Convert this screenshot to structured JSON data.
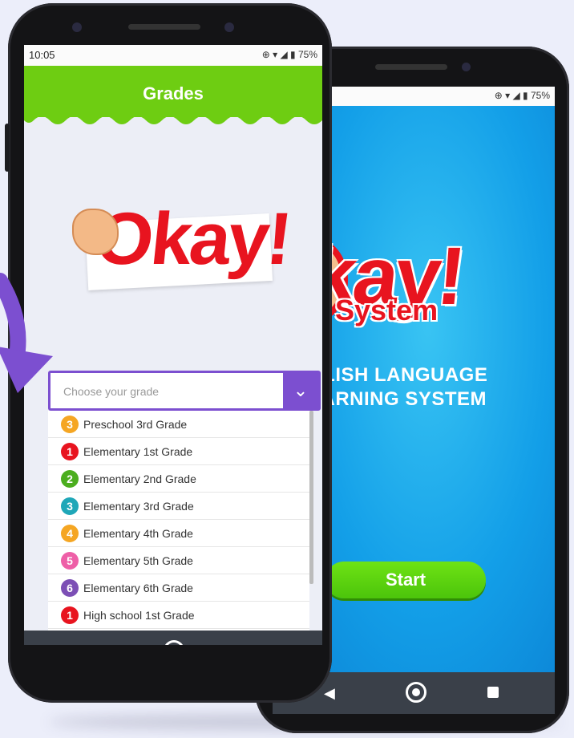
{
  "colors": {
    "header_green": "#6ecd12",
    "accent_purple": "#7c4fd0",
    "logo_red": "#e8141f",
    "background": "#eceefa"
  },
  "front_phone": {
    "status": {
      "time": "10:05",
      "battery": "75%"
    },
    "header_title": "Grades",
    "logo_text": "Okay!",
    "grade_select": {
      "placeholder": "Choose your grade",
      "toggle_icon": "chevron-down-icon"
    },
    "grades": [
      {
        "badge": "3",
        "label": "Preschool 3rd Grade",
        "color": "#f5a623"
      },
      {
        "badge": "1",
        "label": "Elementary 1st Grade",
        "color": "#e8141f"
      },
      {
        "badge": "2",
        "label": "Elementary 2nd Grade",
        "color": "#4cae1f"
      },
      {
        "badge": "3",
        "label": "Elementary 3rd Grade",
        "color": "#1fa7b8"
      },
      {
        "badge": "4",
        "label": "Elementary 4th Grade",
        "color": "#f5a623"
      },
      {
        "badge": "5",
        "label": "Elementary 5th Grade",
        "color": "#ee5fa7"
      },
      {
        "badge": "6",
        "label": "Elementary 6th Grade",
        "color": "#7c4fb5"
      },
      {
        "badge": "1",
        "label": "High school 1st Grade",
        "color": "#e8141f"
      }
    ]
  },
  "back_phone": {
    "status": {
      "battery": "75%"
    },
    "logo_text": "kay!",
    "logo_subtitle": "System",
    "tagline_line1": "GLISH LANGUAGE",
    "tagline_line2": "EARNING SYSTEM",
    "start_label": "Start"
  }
}
